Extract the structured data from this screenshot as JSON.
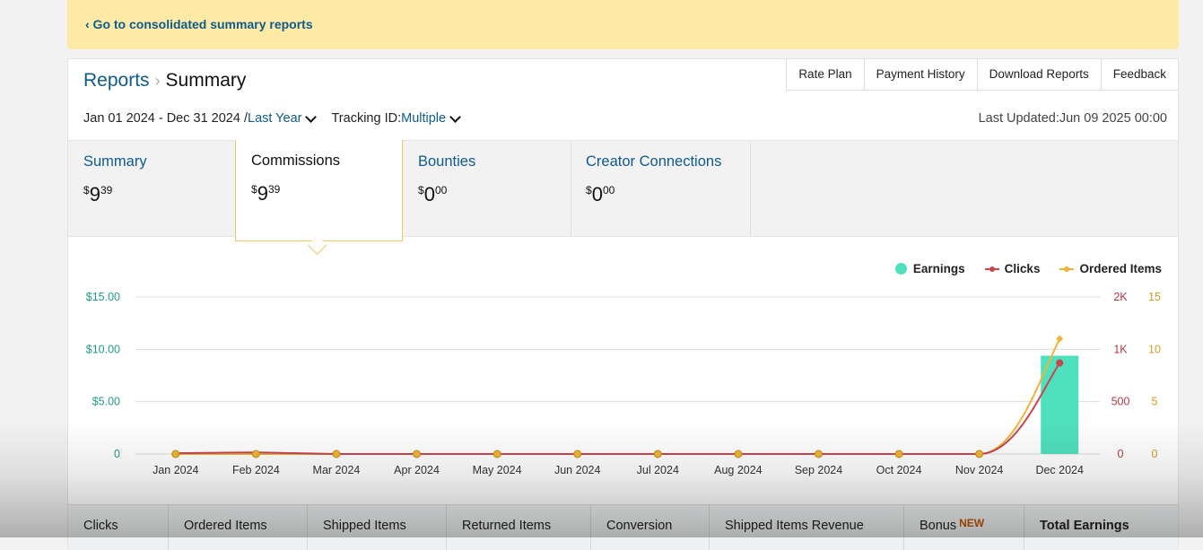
{
  "banner": {
    "link": "‹ Go to consolidated summary reports"
  },
  "breadcrumb": {
    "reports": "Reports",
    "separator": "›",
    "current": "Summary"
  },
  "toplinks": [
    "Rate Plan",
    "Payment History",
    "Download Reports",
    "Feedback"
  ],
  "filters": {
    "date_range": "Jan 01 2024 - Dec 31 2024 /",
    "period": "Last Year",
    "tracking_label": "Tracking ID:",
    "tracking_value": "Multiple"
  },
  "last_updated": "Last Updated:Jun 09 2025 00:00",
  "tabs": [
    {
      "title": "Summary",
      "currency": "$",
      "whole": "9",
      "cents": "39"
    },
    {
      "title": "Commissions",
      "currency": "$",
      "whole": "9",
      "cents": "39"
    },
    {
      "title": "Bounties",
      "currency": "$",
      "whole": "0",
      "cents": "00"
    },
    {
      "title": "Creator Connections",
      "currency": "$",
      "whole": "0",
      "cents": "00"
    }
  ],
  "legend": {
    "earnings": "Earnings",
    "clicks": "Clicks",
    "ordered": "Ordered Items"
  },
  "colors": {
    "earnings": "#4fe0bd",
    "clicks": "#c9464f",
    "ordered": "#f0b536",
    "link": "#0f5b8c"
  },
  "chart_data": {
    "type": "bar",
    "categories": [
      "Jan 2024",
      "Feb 2024",
      "Mar 2024",
      "Apr 2024",
      "May 2024",
      "Jun 2024",
      "Jul 2024",
      "Aug 2024",
      "Sep 2024",
      "Oct 2024",
      "Nov 2024",
      "Dec 2024"
    ],
    "y_left_ticks": [
      "$15.00",
      "$10.00",
      "$5.00",
      "0"
    ],
    "y_mid_ticks": [
      "2K",
      "1K",
      "500",
      "0"
    ],
    "y_right_ticks": [
      "15",
      "10",
      "5",
      "0"
    ],
    "ylim_earnings": [
      0,
      15
    ],
    "ylim_clicks": [
      0,
      1500
    ],
    "ylim_ordered": [
      0,
      15
    ],
    "series": [
      {
        "name": "Earnings",
        "kind": "bar",
        "values": [
          0,
          0,
          0,
          0,
          0,
          0,
          0,
          0,
          0,
          0,
          0,
          9.39
        ]
      },
      {
        "name": "Clicks",
        "kind": "line",
        "values": [
          8,
          15,
          0,
          0,
          0,
          0,
          0,
          0,
          0,
          0,
          0,
          870
        ]
      },
      {
        "name": "Ordered Items",
        "kind": "line",
        "values": [
          0,
          0,
          0,
          0,
          0,
          0,
          0,
          0,
          0,
          0,
          0,
          11
        ]
      }
    ]
  },
  "table_headers": [
    "Clicks",
    "Ordered Items",
    "Shipped Items",
    "Returned Items",
    "Conversion",
    "Shipped Items Revenue",
    "Bonus",
    "Total Earnings"
  ],
  "bonus_badge": "NEW"
}
